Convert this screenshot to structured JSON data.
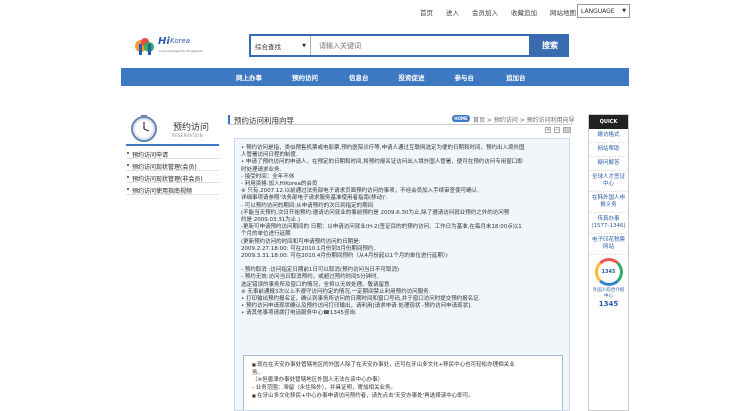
{
  "top_links": [
    "首页",
    "进入",
    "会员加入",
    "收藏追加",
    "网站地图"
  ],
  "language": "LANGUAGE",
  "logo": {
    "hi": "Hi",
    "korea": "Korea",
    "sub": "e-Government for Foreigners"
  },
  "search": {
    "category": "综合查找",
    "placeholder": "请输入关键词",
    "button": "搜索"
  },
  "nav": [
    "网上办事",
    "预约访问",
    "信息台",
    "投资促进",
    "参与台",
    "追加台"
  ],
  "sidebar": {
    "title": "预约访问",
    "subtitle": "RESERVATION",
    "items": [
      "预约访问申请",
      "预约访问现状管理(会员)",
      "预约访问现状管理(非会员)",
      "预约访问使用指南视频"
    ]
  },
  "content": {
    "title": "预约访问利用向导",
    "home": "HOME",
    "breadcrumb": "首页 > 预约访问 > 预约访问利用向导",
    "lines": [
      {
        "t": "预约访问是指，类似预售机票或电影票,预约医院诊疗等,申请人通过互联网选定为便的日期和时间，预约出入境外国",
        "b": true
      },
      {
        "t": "人管署访问日程的制度.",
        "b": false
      },
      {
        "t": "申请了预约访问的申请人，在预定的日期和时间,将预约报名证访问出入境外国人管署，便可在预约访问专用窗口即",
        "b": true
      },
      {
        "t": "时处理请求业务.",
        "b": false
      },
      {
        "t": " - 接受时间：全年不休",
        "b": false
      },
      {
        "t": " - 利用资格:加入HiKorea的会员",
        "b": false
      },
      {
        "t": " ※ 只有,2007.12.以前通过法务部电子请求页面预约访问的事项，不经会员加入手续审查使可确认.",
        "b": false
      },
      {
        "t": "   详细事项请参照'法务部电子请求服务基准使用者指南(移动)'.",
        "b": false
      },
      {
        "t": " - 可以预约访问的期间:从申请预约的次日到指定的期间",
        "b": false
      },
      {
        "t": " (不能当天预约,次日开始预约:遵请访问就业的事前预约是 2009.6.30为止,除了遵请访问就业预约之外的访问预",
        "b": false
      },
      {
        "t": "   约是 2009.03.31为止.)",
        "b": false
      },
      {
        "t": " -更新可申请预约访问期间的 日期：以申请访问就业(H-2)签证目的的预约访问、工作日为基准,在每月末18:00点以1",
        "b": false
      },
      {
        "t": "  个月的单位进行延期",
        "b": false
      },
      {
        "t": "     (更新预约访问的时间和可申请预约访问的日期是:",
        "b": false
      },
      {
        "t": "       2009.2.27.18:00: 可在2010.1月份到3月份期间预约,",
        "b": false
      },
      {
        "t": "       2009.3.31.18:00: 可在2010.4月份期间预约（从4月份起以1个月的单位进行延期）)",
        "b": false
      },
      {
        "t": "",
        "b": false
      },
      {
        "t": " - 预约取消 :访问指定日期前1日可以取消(预约访问当日不可取消)",
        "b": false
      },
      {
        "t": " - 预约无效:访问当日取消预约，或超过预约时间5分钟时,",
        "b": false
      },
      {
        "t": "  选定错误的事务所及窗口的情况，全将以无效处理。敬请留意.",
        "b": false
      },
      {
        "t": " ※ 无事前通报3次以上不遵守访问约定的情况,一定期间禁止利用预约访问服务.",
        "b": false
      },
      {
        "t": "打印输出预约报名证，确认到事务所访问的日期时间和窗口号码,并于窗口访问时提交预约报名证.",
        "b": true
      },
      {
        "t": "预约访问申请现状确认及预约访问打印输出，请利用[请求申请·处理现状 -预约访问申请现状].",
        "b": true
      },
      {
        "t": "请其他事项请拨打电话服务中心☎1345咨询.",
        "b": true
      }
    ],
    "notice": [
      {
        "t": "现在在天安办事处管辖地区的外国人除了在天安办事处，还可在牙山多文化+移民中心也可轻松办理相关业",
        "sq": true
      },
      {
        "t": "务。",
        "sq": false
      },
      {
        "t": "         （※但唐津办事处管辖地区外国人无法在该中心办事）",
        "sq": false
      },
      {
        "t": "         - 业务范围：滞留（永住除外），并具证明，寄加相关业务。",
        "sq": false
      },
      {
        "t": "在牙山多文化移民+中心办事申请访问预约者，请先点击'天安办事处'再选择该中心即可。",
        "sq": true
      }
    ]
  },
  "quick": {
    "head": "QUICK",
    "items": [
      "缴访格式",
      "网站帮助",
      "疑问解答",
      "全球人才签证中心",
      "在韩外国人申报义务",
      "传真办事 (1577-1346)",
      "电子印花税票网站"
    ],
    "badge_text": "外国人綜合介紹中心",
    "badge_num": "1345",
    "badge_circle": "1345"
  },
  "colors": {
    "brand": "#3d78c2",
    "box_bg": "#f1f6fb"
  }
}
